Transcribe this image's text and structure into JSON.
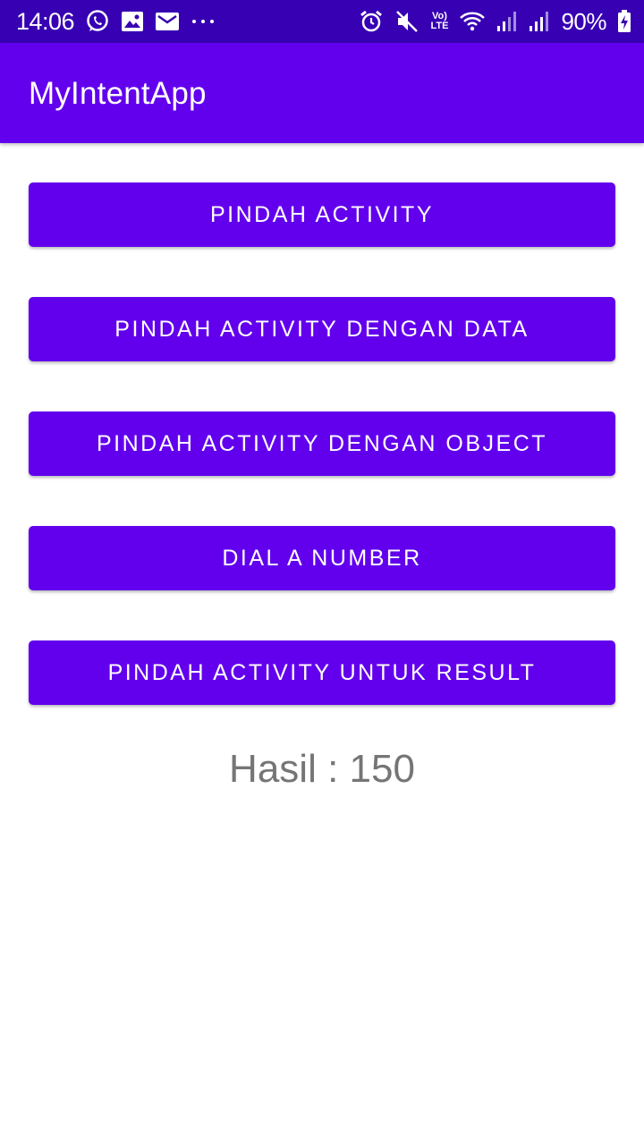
{
  "status_bar": {
    "time": "14:06",
    "battery": "90%",
    "network_label_top": "Vo)",
    "network_label_bottom": "LTE",
    "icons": [
      "whatsapp-icon",
      "gallery-icon",
      "mail-icon",
      "more-dots-icon",
      "alarm-icon",
      "mute-icon",
      "volte-icon",
      "wifi-icon",
      "signal-icon",
      "signal-icon",
      "battery-charging-icon"
    ]
  },
  "app_bar": {
    "title": "MyIntentApp"
  },
  "buttons": {
    "move_activity": "PINDAH ACTIVITY",
    "move_with_data": "PINDAH ACTIVITY DENGAN DATA",
    "move_with_object": "PINDAH ACTIVITY DENGAN OBJECT",
    "dial_number": "DIAL A NUMBER",
    "move_for_result": "PINDAH ACTIVITY UNTUK RESULT"
  },
  "result": {
    "text": "Hasil : 150"
  },
  "colors": {
    "status_bar": "#3700b3",
    "primary": "#6200ee",
    "result_text": "#757575"
  }
}
